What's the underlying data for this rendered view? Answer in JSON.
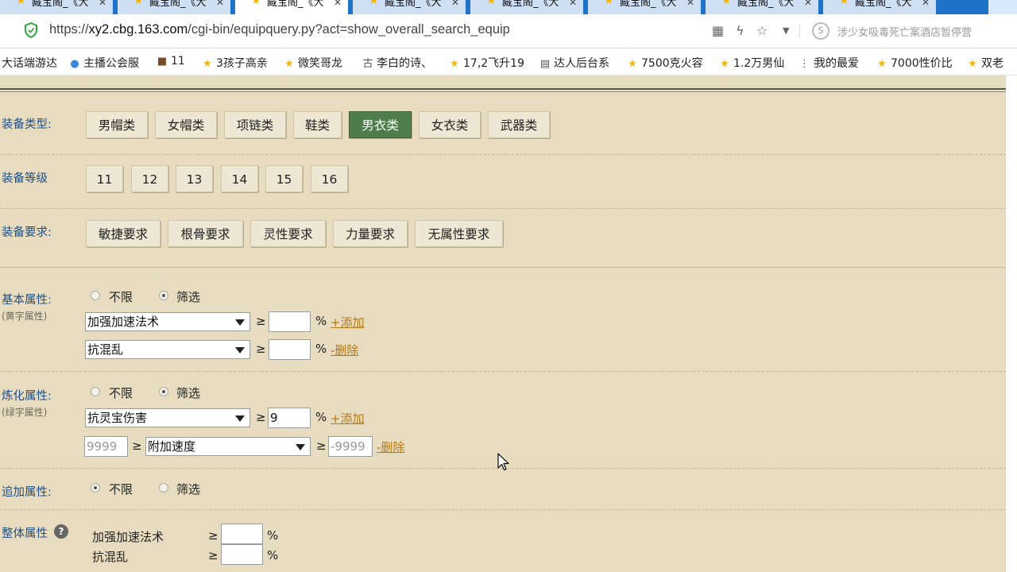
{
  "browser": {
    "tabs": [
      {
        "title": "藏宝阁_《大"
      },
      {
        "title": "藏宝阁_《大"
      },
      {
        "title": "藏宝阁_《大"
      },
      {
        "title": "藏宝阁_《大"
      },
      {
        "title": "藏宝阁_《大"
      },
      {
        "title": "藏宝阁_《大"
      },
      {
        "title": "藏宝阁_《大"
      },
      {
        "title": "藏宝阁_《大"
      }
    ],
    "url_prefix": "https://",
    "url_host": "xy2.cbg.163.com",
    "url_path": "/cgi-bin/equipquery.py?act=show_overall_search_equip",
    "search_placeholder": "涉少女吸毒死亡案酒店暂停营",
    "bookmarks": [
      {
        "label": "大话端游达",
        "icon": "none"
      },
      {
        "label": "主播公会服",
        "icon": "globe-icon"
      },
      {
        "label": "11",
        "icon": "game-icon"
      },
      {
        "label": "3孩子高亲",
        "icon": "star-icon"
      },
      {
        "label": "微笑哥龙",
        "icon": "star-icon"
      },
      {
        "label": "李白的诗、",
        "icon": "text-icon"
      },
      {
        "label": "17,2飞升19",
        "icon": "star-icon"
      },
      {
        "label": "达人后台系",
        "icon": "doc-icon"
      },
      {
        "label": "7500克火容",
        "icon": "star-icon"
      },
      {
        "label": "1.2万男仙",
        "icon": "star-icon"
      },
      {
        "label": "我的最爱",
        "icon": "grid-icon"
      },
      {
        "label": "7000性价比",
        "icon": "star-icon"
      },
      {
        "label": "双老",
        "icon": "star-icon"
      }
    ]
  },
  "form": {
    "equip_type": {
      "label": "装备类型:",
      "options": [
        "男帽类",
        "女帽类",
        "项链类",
        "鞋类",
        "男衣类",
        "女衣类",
        "武器类"
      ],
      "selected": "男衣类"
    },
    "equip_level": {
      "label": "装备等级",
      "options": [
        "11",
        "12",
        "13",
        "14",
        "15",
        "16"
      ]
    },
    "equip_req": {
      "label": "装备要求:",
      "options": [
        "敏捷要求",
        "根骨要求",
        "灵性要求",
        "力量要求",
        "无属性要求"
      ]
    },
    "basic_attr": {
      "label": "基本属性:",
      "sublabel": "(黄字属性)",
      "radio_unlimited": "不限",
      "radio_filter": "筛选",
      "selected_radio": "筛选",
      "rows": [
        {
          "select": "加强加速法术",
          "op": "≥",
          "value": "",
          "unit": "%",
          "action": "+添加"
        },
        {
          "select": "抗混乱",
          "op": "≥",
          "value": "",
          "unit": "%",
          "action": "-删除"
        }
      ]
    },
    "refine_attr": {
      "label": "炼化属性:",
      "sublabel": "(绿字属性)",
      "radio_unlimited": "不限",
      "radio_filter": "筛选",
      "selected_radio": "筛选",
      "row1": {
        "select": "抗灵宝伤害",
        "op": "≥",
        "value": "9",
        "unit": "%",
        "action": "+添加"
      },
      "row2": {
        "left_placeholder": "9999",
        "op1": "≥",
        "select": "附加速度",
        "op2": "≥",
        "right_placeholder": "-9999",
        "action": "-删除"
      }
    },
    "extra_attr": {
      "label": "追加属性:",
      "radio_unlimited": "不限",
      "radio_filter": "筛选",
      "selected_radio": "不限"
    },
    "overall_attr": {
      "label": "整体属性",
      "help": "?",
      "rows": [
        {
          "name": "加强加速法术",
          "op": "≥",
          "value": "",
          "unit": "%"
        },
        {
          "name": "抗混乱",
          "op": "≥",
          "value": "",
          "unit": "%"
        }
      ]
    }
  },
  "colors": {
    "page_bg": "#e8dcc0",
    "active_button": "#4f7e4c",
    "label_blue": "#1f4f86",
    "link": "#b07a1a",
    "tab_strip": "#1e73c8"
  }
}
